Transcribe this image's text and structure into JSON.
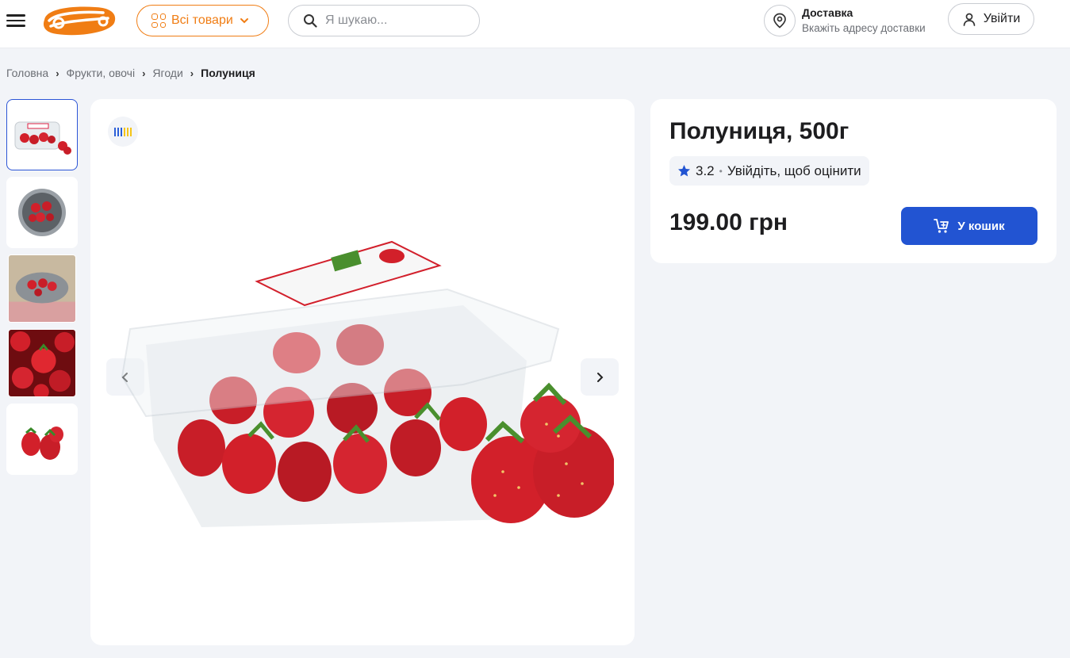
{
  "header": {
    "all_goods_label": "Всі товари",
    "search_placeholder": "Я шукаю...",
    "delivery_title": "Доставка",
    "delivery_subtitle": "Вкажіть адресу доставки",
    "login_label": "Увійти",
    "brand_color": "#f07d14"
  },
  "breadcrumb": {
    "items": [
      "Головна",
      "Фрукти, овочі",
      "Ягоди"
    ],
    "current": "Полуниця"
  },
  "product": {
    "title": "Полуниця, 500г",
    "rating": "3.2",
    "rate_prompt": "Увійдіть, щоб оцінити",
    "price": "199.00 грн",
    "add_to_cart_label": "У кошик",
    "thumbnail_count": 5
  },
  "colors": {
    "accent_blue": "#2254d2",
    "star": "#2254d2",
    "background": "#f2f4f8"
  }
}
